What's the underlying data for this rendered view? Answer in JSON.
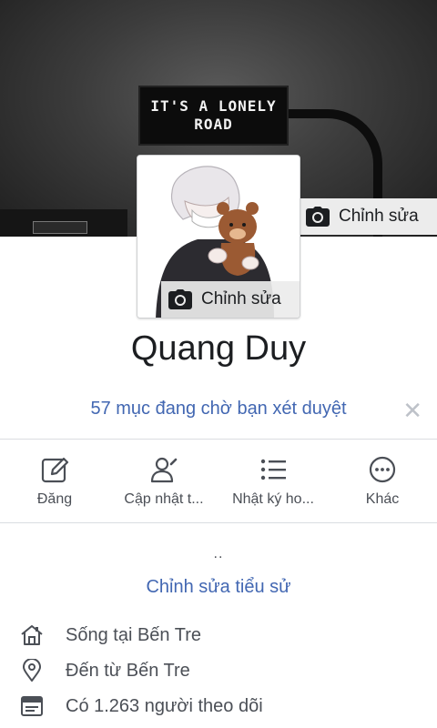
{
  "cover": {
    "sign_line1": "IT'S A LONELY",
    "sign_line2": "ROAD",
    "edit_label": "Chỉnh sửa",
    "edit_icon": "camera-icon"
  },
  "avatar": {
    "edit_label": "Chỉnh sửa",
    "edit_icon": "camera-icon"
  },
  "profile": {
    "name": "Quang Duy"
  },
  "pending": {
    "text": "57 mục đang chờ bạn xét duyệt",
    "close": "✕"
  },
  "actions": [
    {
      "label": "Đăng",
      "icon": "edit-post-icon"
    },
    {
      "label": "Cập nhật t...",
      "icon": "update-info-icon"
    },
    {
      "label": "Nhật ký ho...",
      "icon": "activity-log-icon"
    },
    {
      "label": "Khác",
      "icon": "more-icon"
    }
  ],
  "bio": {
    "text": "..",
    "edit_link": "Chỉnh sửa tiểu sử"
  },
  "info": [
    {
      "text": "Sống tại Bến Tre",
      "icon": "home-icon"
    },
    {
      "text": "Đến từ Bến Tre",
      "icon": "location-pin-icon"
    },
    {
      "text": "Có 1.263 người theo dõi",
      "icon": "followers-icon"
    }
  ],
  "colors": {
    "link": "#4267b2",
    "text": "#1c1e21",
    "secondary": "#4b4f56",
    "divider": "#dadde1"
  }
}
